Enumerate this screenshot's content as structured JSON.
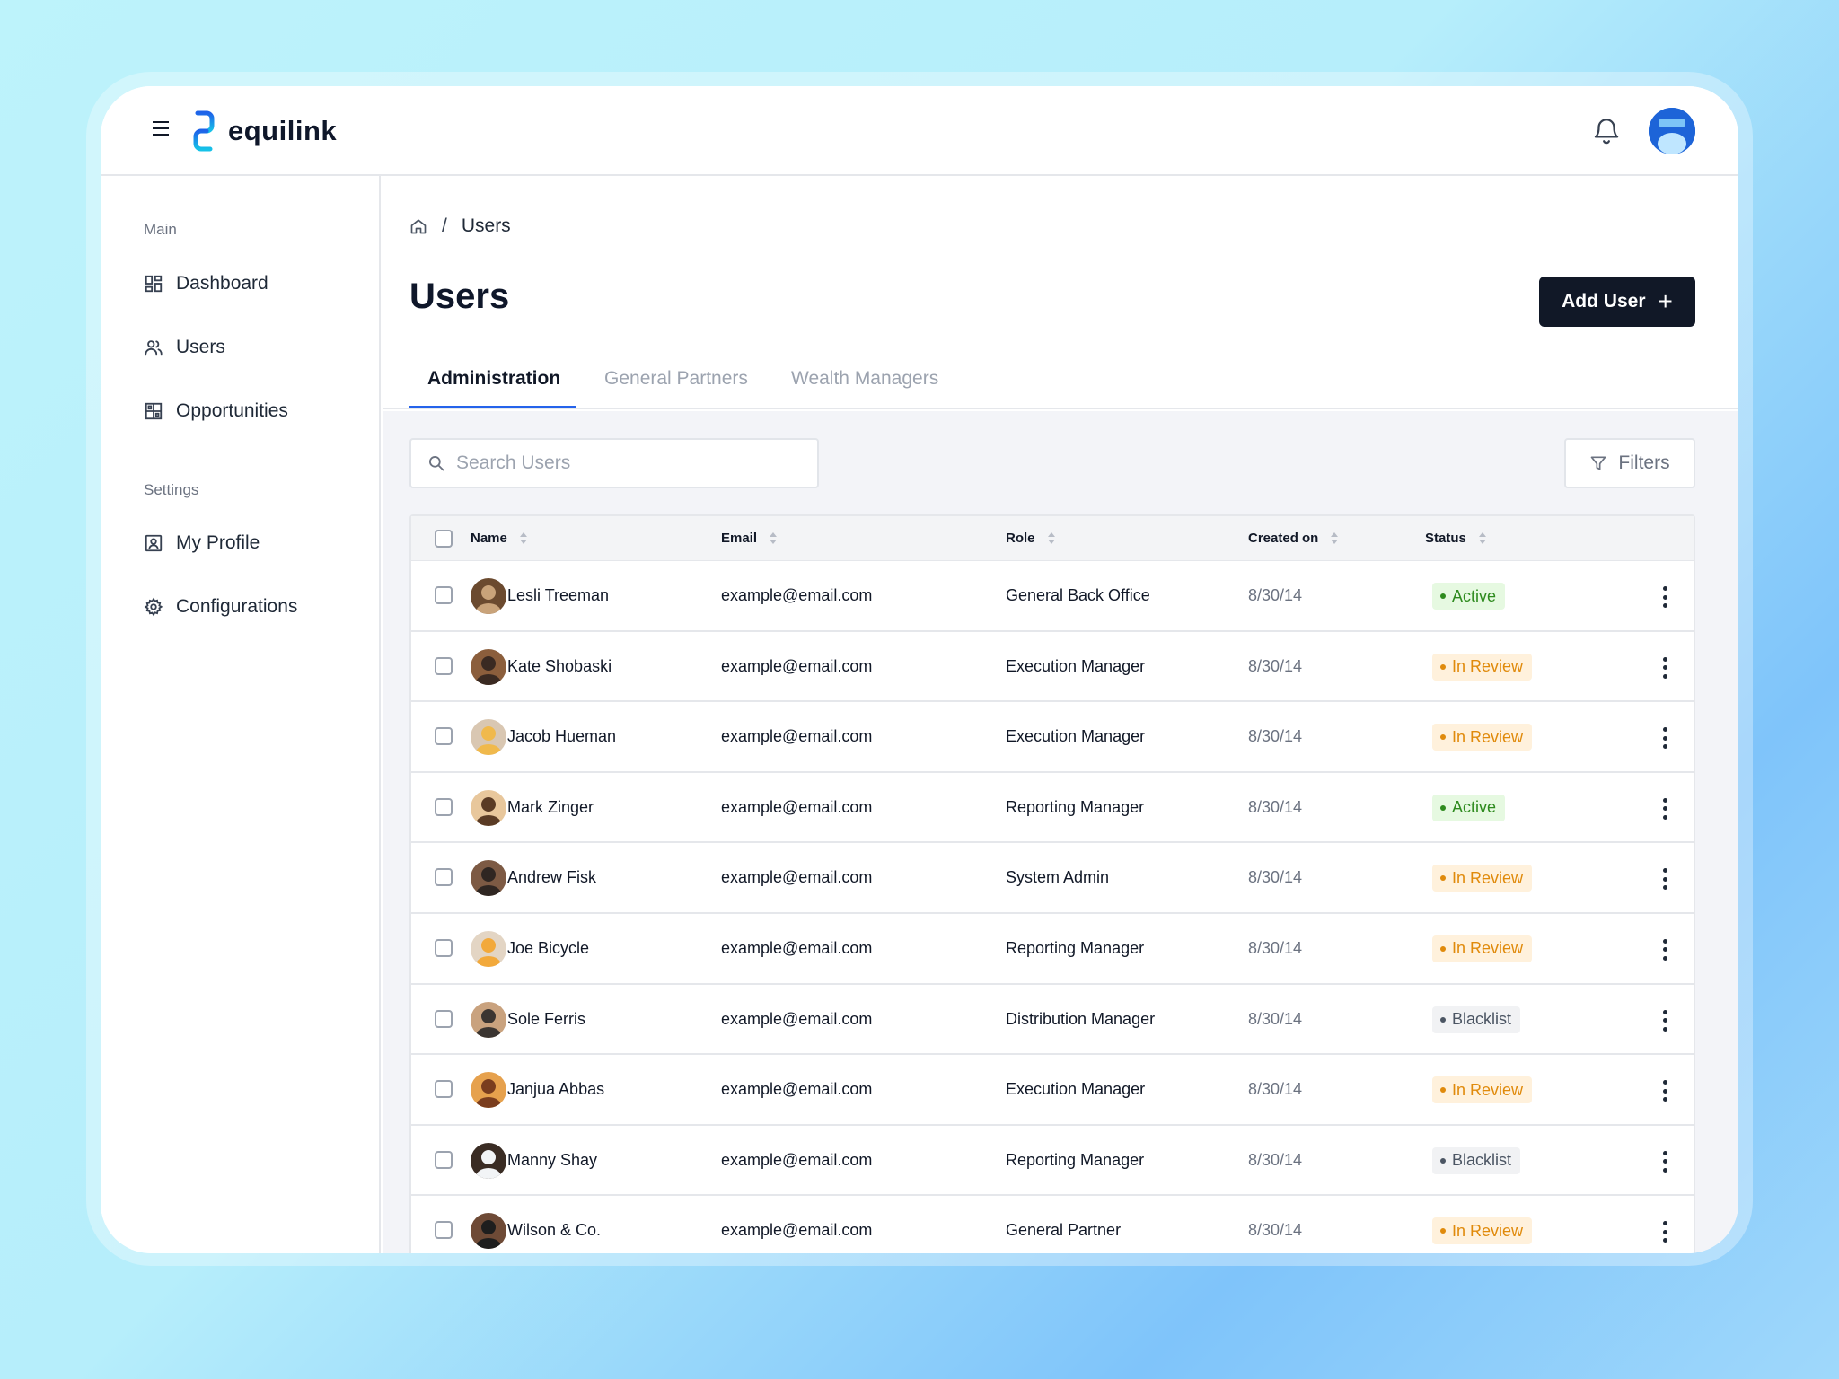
{
  "app": {
    "brand": "equilink"
  },
  "sidebar": {
    "sections": [
      {
        "label": "Main"
      },
      {
        "label": "Settings"
      }
    ],
    "items": [
      {
        "label": "Dashboard",
        "icon": "dashboard-icon"
      },
      {
        "label": "Users",
        "icon": "users-icon"
      },
      {
        "label": "Opportunities",
        "icon": "opportunities-icon"
      },
      {
        "label": "My Profile",
        "icon": "profile-icon"
      },
      {
        "label": "Configurations",
        "icon": "gear-icon"
      }
    ]
  },
  "breadcrumb": {
    "current": "Users",
    "separator": "/"
  },
  "page": {
    "title": "Users",
    "add_button": "Add User"
  },
  "tabs": [
    {
      "label": "Administration",
      "active": true
    },
    {
      "label": "General Partners",
      "active": false
    },
    {
      "label": "Wealth Managers",
      "active": false
    }
  ],
  "search": {
    "placeholder": "Search Users",
    "value": ""
  },
  "filters": {
    "label": "Filters"
  },
  "table": {
    "columns": [
      "Name",
      "Email",
      "Role",
      "Created on",
      "Status"
    ],
    "rows": [
      {
        "name": "Lesli Treeman",
        "email": "example@email.com",
        "role": "General Back Office",
        "created": "8/30/14",
        "status": "Active"
      },
      {
        "name": "Kate Shobaski",
        "email": "example@email.com",
        "role": "Execution Manager",
        "created": "8/30/14",
        "status": "In Review"
      },
      {
        "name": "Jacob Hueman",
        "email": "example@email.com",
        "role": "Execution Manager",
        "created": "8/30/14",
        "status": "In Review"
      },
      {
        "name": "Mark Zinger",
        "email": "example@email.com",
        "role": "Reporting Manager",
        "created": "8/30/14",
        "status": "Active"
      },
      {
        "name": "Andrew Fisk",
        "email": "example@email.com",
        "role": "System Admin",
        "created": "8/30/14",
        "status": "In Review"
      },
      {
        "name": "Joe Bicycle",
        "email": "example@email.com",
        "role": "Reporting Manager",
        "created": "8/30/14",
        "status": "In Review"
      },
      {
        "name": "Sole Ferris",
        "email": "example@email.com",
        "role": "Distribution Manager",
        "created": "8/30/14",
        "status": "Blacklist"
      },
      {
        "name": "Janjua Abbas",
        "email": "example@email.com",
        "role": "Execution Manager",
        "created": "8/30/14",
        "status": "In Review"
      },
      {
        "name": "Manny Shay",
        "email": "example@email.com",
        "role": "Reporting Manager",
        "created": "8/30/14",
        "status": "Blacklist"
      },
      {
        "name": "Wilson & Co.",
        "email": "example@email.com",
        "role": "General Partner",
        "created": "8/30/14",
        "status": "In Review"
      }
    ]
  },
  "colors": {
    "accent": "#2563eb",
    "button_dark": "#111827",
    "status_active": {
      "bg": "#e6f9e1",
      "fg": "#2e8b1e"
    },
    "status_review": {
      "bg": "#fff1dc",
      "fg": "#e08a0b"
    },
    "status_blacklist": {
      "bg": "#f1f2f4",
      "fg": "#4b5563"
    }
  }
}
